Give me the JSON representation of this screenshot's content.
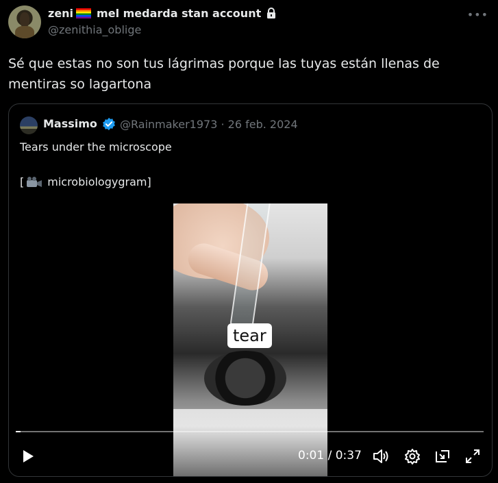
{
  "author": {
    "name": "zeni",
    "name_suffix": "mel medarda stan account",
    "handle": "@zenithia_oblige"
  },
  "tweet": {
    "text_line1": "Sé que estas no son tus lágrimas porque las tuyas están llenas de",
    "text_line2": "mentiras so lagartona"
  },
  "quote": {
    "name": "Massimo",
    "handle": "@Rainmaker1973",
    "separator": "·",
    "date": "26 feb. 2024",
    "line1": "Tears under the microscope",
    "line2_open": "[",
    "line2_text": "microbiologygram]",
    "video": {
      "overlay_label": "tear",
      "current_time": "0:01",
      "time_sep": "/",
      "duration": "0:37",
      "progress_fraction": 0.01
    }
  },
  "icons": {
    "lock": "lock-icon",
    "verified": "verified-badge-icon",
    "more": "more-icon",
    "camera": "video-camera-icon",
    "play": "play-icon",
    "volume": "volume-icon",
    "settings": "gear-icon",
    "pip": "picture-in-picture-icon",
    "fullscreen": "fullscreen-icon"
  },
  "colors": {
    "background": "#000000",
    "text": "#e7e9ea",
    "secondary_text": "#71767b",
    "verified": "#1d9bf0",
    "border": "#333639"
  }
}
